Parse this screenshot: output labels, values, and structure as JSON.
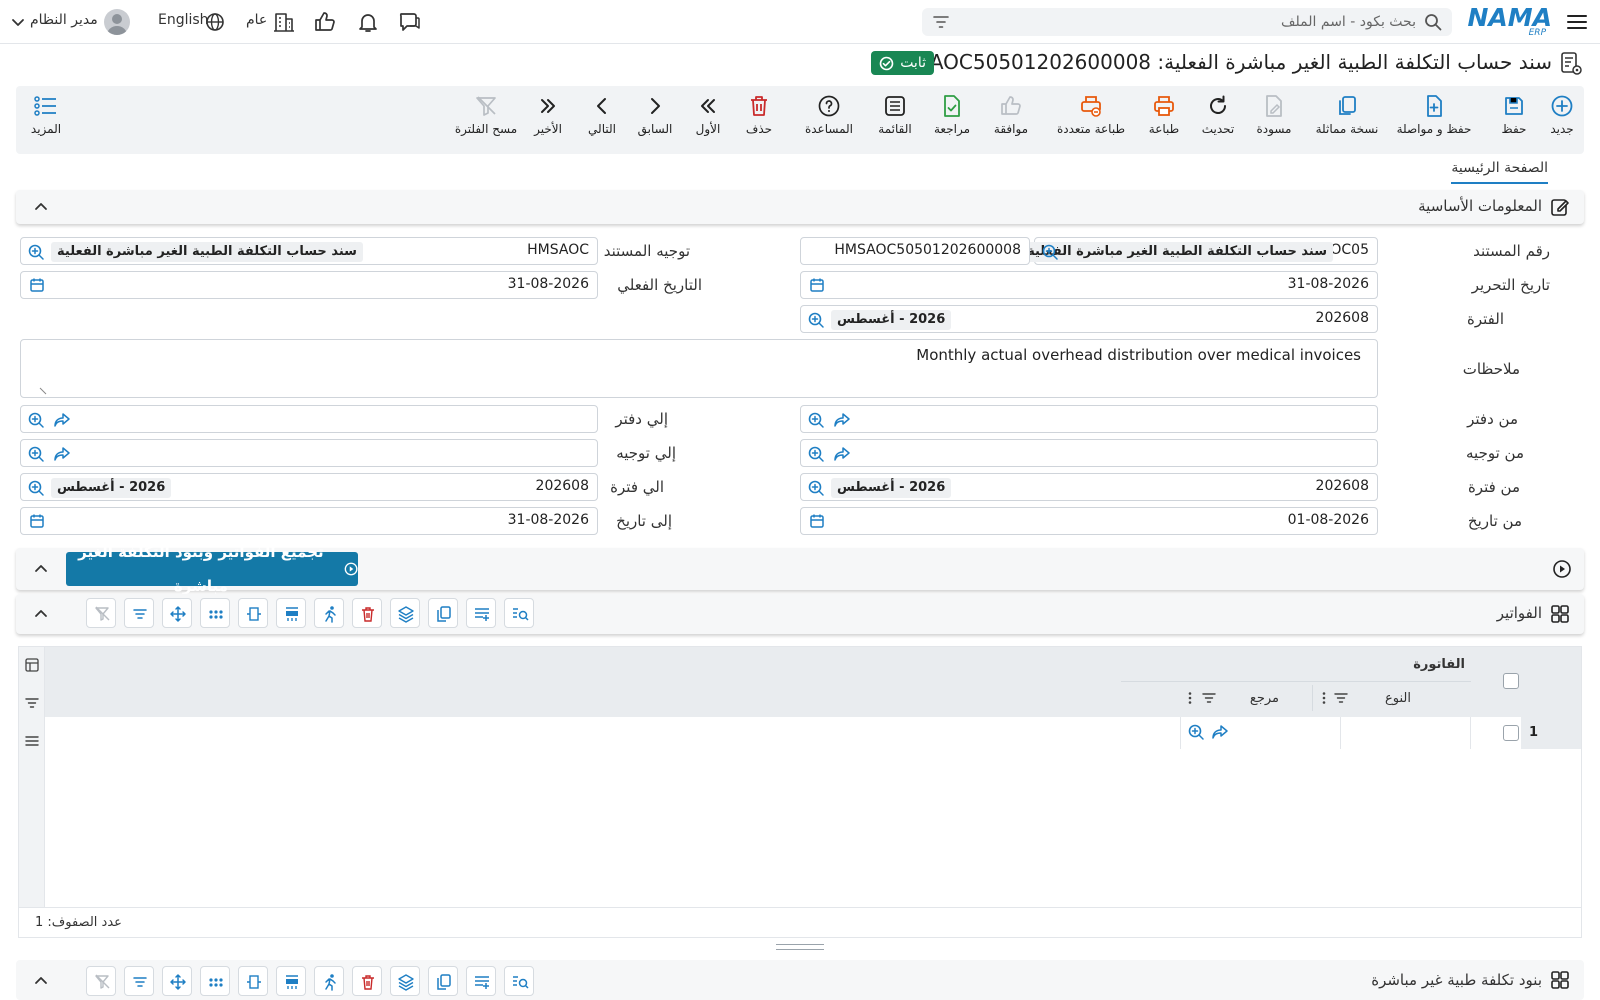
{
  "topbar": {
    "logo_main": "NAMA",
    "logo_sub": "ERP",
    "search_placeholder": "بحث بكود - اسم الملف",
    "user_name": "مدير النظام",
    "language": "English",
    "scope": "عام"
  },
  "title": {
    "text": "سند حساب التكلفة الطبية الغير مباشرة الفعلية: HMSAOC50501202600008",
    "status": "ثابت"
  },
  "toolbar": {
    "new": "جديد",
    "save": "حفظ",
    "save_continue": "حفظ و مواصلة",
    "duplicate": "نسخة مماثلة",
    "draft": "مسودة",
    "refresh": "تحديث",
    "print": "طباعة",
    "multi_print": "طباعة متعددة",
    "approve": "موافقة",
    "review": "مراجعة",
    "list": "القائمة",
    "help": "المساعدة",
    "delete": "حذف",
    "first": "الأول",
    "previous": "السابق",
    "next": "التالي",
    "last": "الأخير",
    "clear_filter": "مسح الفلترة",
    "more": "المزيد"
  },
  "tabs": {
    "main": "الصفحة الرئيسية"
  },
  "basic_info": {
    "title": "المعلومات الأساسية",
    "doc_number_label": "رقم المستند",
    "doc_number_code": "OC05",
    "doc_number_chip": "سند حساب التكلفة الطبية الغير مباشرة الفعلية",
    "doc_number_value": "HMSAOC50501202600008",
    "direction_label": "توجيه المستند",
    "direction_code": "HMSAOC",
    "direction_chip": "سند حساب التكلفة الطبية الغير مباشرة الفعلية",
    "edit_date_label": "تاريخ التحرير",
    "edit_date": "31-08-2026",
    "actual_date_label": "التاريخ الفعلي",
    "actual_date": "31-08-2026",
    "period_label": "الفترة",
    "period_code": "202608",
    "period_chip": "2026 - أغسطس",
    "notes_label": "ملاحظات",
    "notes": "Monthly actual overhead distribution over medical invoices",
    "from_book_label": "من دفتر",
    "to_book_label": "إلي دفتر",
    "from_direction_label": "من توجيه",
    "to_direction_label": "إلي توجيه",
    "from_period_label": "من فترة",
    "from_period_code": "202608",
    "from_period_chip": "2026 - أغسطس",
    "to_period_label": "الي فترة",
    "to_period_code": "202608",
    "to_period_chip": "2026 - أغسطس",
    "from_date_label": "من تاريخ",
    "from_date": "01-08-2026",
    "to_date_label": "إلى تاريخ",
    "to_date": "31-08-2026"
  },
  "process": {
    "button": "تجميع الفواتير وبنود التكلفة الغير مباشرة"
  },
  "invoices": {
    "title": "الفواتير",
    "group_header": "الفاتورة",
    "col_type": "النوع",
    "col_ref": "مرجع",
    "rows": [
      {
        "num": "1"
      }
    ],
    "row_count": "عدد الصفوف: 1"
  },
  "cost_items": {
    "title": "بنود تكلفة طبية غير مباشرة"
  },
  "colors": {
    "accent": "#1f7fc4",
    "status_green": "#198754",
    "process_button": "#1479a7",
    "delete_red": "#d9534f"
  }
}
